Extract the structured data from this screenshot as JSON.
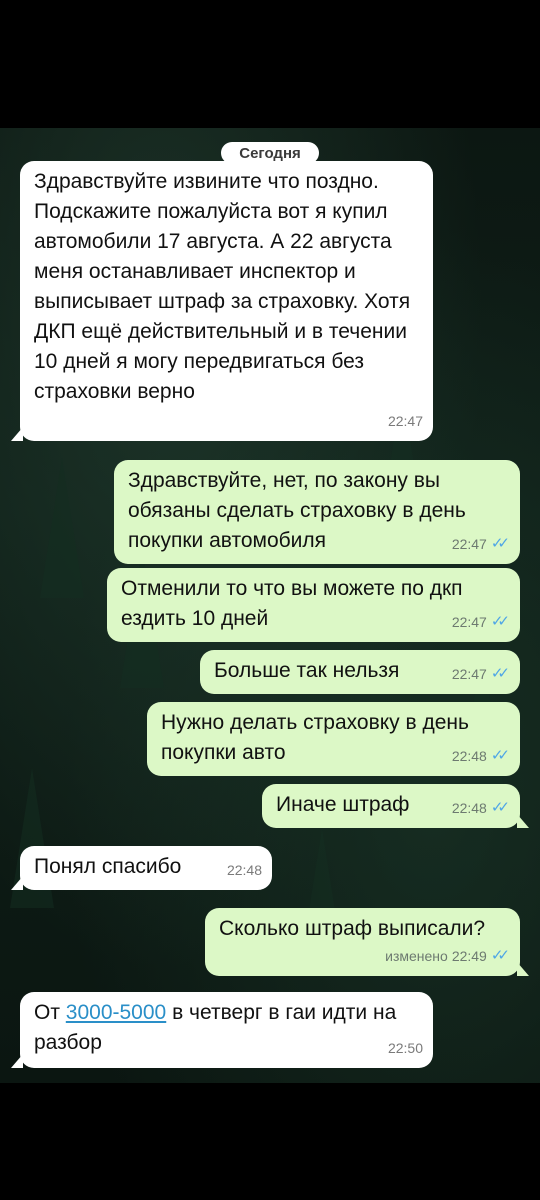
{
  "date_divider": "Сегодня",
  "messages": [
    {
      "text": "Здравствуйте извините что поздно. Подскажите пожалуйста вот я купил автомобили 17 августа. А 22 августа меня останавливает инспектор и выписывает штраф за страховку. Хотя ДКП ещё действительный и в течении 10 дней я могу передвигаться без страховки верно",
      "time": "22:47"
    },
    {
      "text": "Здравствуйте, нет, по закону вы обязаны сделать страховку в день покупки автомобиля",
      "time": "22:47",
      "status": "read"
    },
    {
      "text": "Отменили то что вы можете по дкп ездить 10 дней",
      "time": "22:47",
      "status": "read"
    },
    {
      "text": "Больше так нельзя",
      "time": "22:47",
      "status": "read"
    },
    {
      "text": "Нужно делать страховку в день покупки авто",
      "time": "22:48",
      "status": "read"
    },
    {
      "text": "Иначе штраф",
      "time": "22:48",
      "status": "read"
    },
    {
      "text": "Понял спасибо",
      "time": "22:48"
    },
    {
      "text": "Сколько штраф выписали?",
      "edited": "изменено",
      "time": "22:49",
      "status": "read"
    },
    {
      "text_before": "От ",
      "link": "3000-5000",
      "text_after": " в четверг в гаи идти на разбор",
      "time": "22:50"
    }
  ],
  "colors": {
    "outgoing": "#dcf8c6",
    "incoming": "#ffffff",
    "read_ticks": "#4fa6e6",
    "link": "#2a8fc8"
  }
}
